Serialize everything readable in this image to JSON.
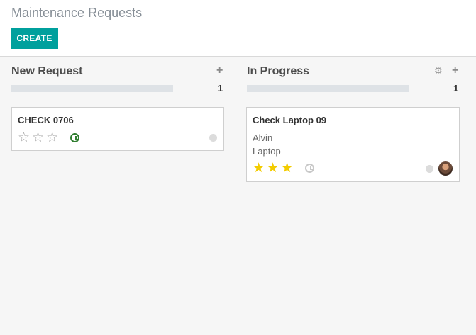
{
  "header": {
    "breadcrumb": "Maintenance Requests",
    "create_label": "CREATE"
  },
  "colors": {
    "accent": "#00a09d",
    "star_filled": "#f3cc00",
    "activity_ok": "#2f7d2f"
  },
  "columns": [
    {
      "title": "New Request",
      "count": "1",
      "icons": [
        "plus-icon"
      ],
      "cards": [
        {
          "title": "CHECK 0706",
          "lines": [],
          "priority": 0,
          "priority_max": 3,
          "activity": "clock-icon-green"
        }
      ]
    },
    {
      "title": "In Progress",
      "count": "1",
      "icons": [
        "gear-icon",
        "plus-icon"
      ],
      "cards": [
        {
          "title": "Check Laptop 09",
          "lines": [
            "Alvin",
            "Laptop"
          ],
          "priority": 3,
          "priority_max": 3,
          "activity": "clock-icon-grey",
          "avatar": "user-avatar"
        }
      ]
    }
  ]
}
